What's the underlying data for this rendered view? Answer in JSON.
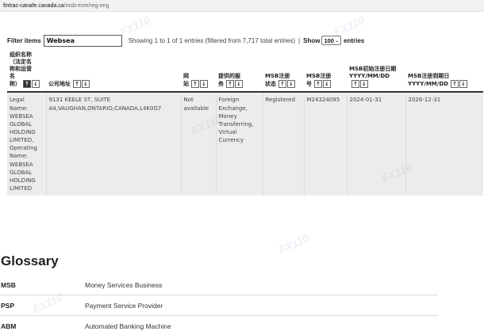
{
  "url": {
    "host": "fintrac-canafe.canada.ca",
    "path": "/msb-esm/reg-eng"
  },
  "filter": {
    "label": "Filter items",
    "value": "Websea",
    "info": "Showing 1 to 1 of 1 entries (filtered from 7,717 total entries)",
    "separator": "|",
    "show_label": "Show",
    "show_value": "100",
    "entries_label": "entries"
  },
  "table": {
    "headers": [
      "组织名称（法定名称和运营名称）",
      "公司地址",
      "网站",
      "提供的服务",
      "MSB注册状态",
      "MSB注册号",
      "MSB初始注册日期 YYYY/MM/DD",
      "MSB注册到期日 YYYY/MM/DD"
    ],
    "header_lines": [
      [
        "组织名称",
        "（法定名",
        "称和运营",
        "名",
        "称）"
      ],
      [
        "公司地址"
      ],
      [
        "网",
        "站"
      ],
      [
        "提供的服",
        "务"
      ],
      [
        "MSB注册",
        "状态"
      ],
      [
        "MSB注册",
        "号"
      ],
      [
        "MSB初始注册日期",
        "YYYY/MM/DD"
      ],
      [
        "MSB注册到期日",
        "YYYY/MM/DD"
      ]
    ],
    "sort_up": "↑",
    "sort_down": "↓",
    "rows": [
      {
        "name": "Legal Name: WEBSEA GLOBAL HOLDING LIMITED, Operating Name: WEBSEA GLOBAL HOLDING LIMITED",
        "address": "9131 KEELE ST, SUITE A4,VAUGHAN,ONTARIO,CANADA,L4K0G7",
        "website": "Not available",
        "services": "Foreign Exchange, Money Transferring, Virtual Currency",
        "status": "Registered",
        "reg_number": "M24324095",
        "initial_date": "2024-01-31",
        "expiry_date": "2026-12-31"
      }
    ]
  },
  "glossary": {
    "title": "Glossary",
    "items": [
      {
        "term": "MSB",
        "definition": "Money Services Business"
      },
      {
        "term": "PSP",
        "definition": "Payment Service Provider"
      },
      {
        "term": "ABM",
        "definition": "Automated Banking Machine"
      }
    ]
  }
}
